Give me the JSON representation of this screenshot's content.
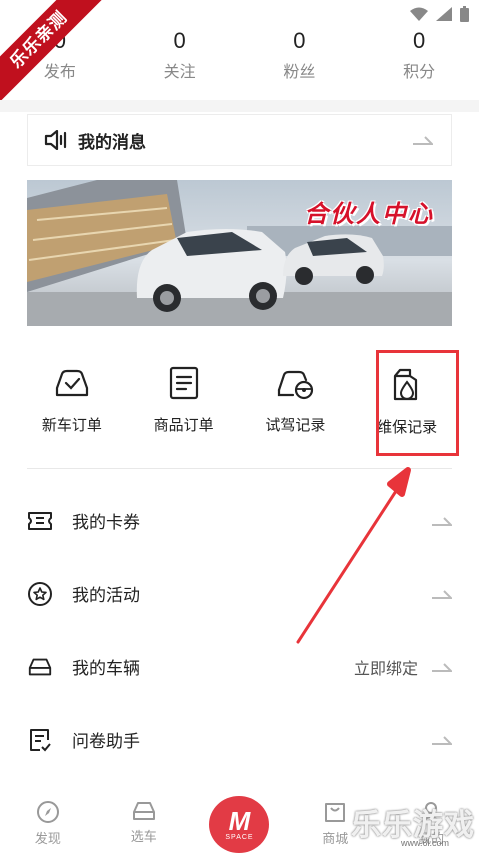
{
  "corner_badge": "乐乐亲测",
  "stats": [
    {
      "value": "0",
      "label": "发布"
    },
    {
      "value": "0",
      "label": "关注"
    },
    {
      "value": "0",
      "label": "粉丝"
    },
    {
      "value": "0",
      "label": "积分"
    }
  ],
  "messages": {
    "label": "我的消息"
  },
  "banner": {
    "title": "合伙人中心"
  },
  "quick": [
    {
      "label": "新车订单",
      "icon": "car-check-icon"
    },
    {
      "label": "商品订单",
      "icon": "document-icon"
    },
    {
      "label": "试驾记录",
      "icon": "steering-wheel-car-icon"
    },
    {
      "label": "维保记录",
      "icon": "oil-can-icon"
    }
  ],
  "list": [
    {
      "label": "我的卡券",
      "icon": "ticket-icon",
      "extra": ""
    },
    {
      "label": "我的活动",
      "icon": "star-circle-icon",
      "extra": ""
    },
    {
      "label": "我的车辆",
      "icon": "car-front-icon",
      "extra": "立即绑定"
    },
    {
      "label": "问卷助手",
      "icon": "survey-icon",
      "extra": ""
    }
  ],
  "nav": [
    {
      "label": "发现",
      "icon": "compass-icon"
    },
    {
      "label": "选车",
      "icon": "car-icon"
    },
    {
      "label": "",
      "icon": "m-space-icon"
    },
    {
      "label": "商城",
      "icon": "shopping-bag-icon"
    },
    {
      "label": "我的",
      "icon": "user-icon"
    }
  ],
  "center_button": {
    "letter": "M",
    "sub": "SPACE"
  },
  "watermark": {
    "text": "乐乐游戏",
    "url": "www.6l.com"
  },
  "colors": {
    "accent": "#e23b45",
    "highlight": "#e8343a",
    "badge": "#c0101e"
  }
}
